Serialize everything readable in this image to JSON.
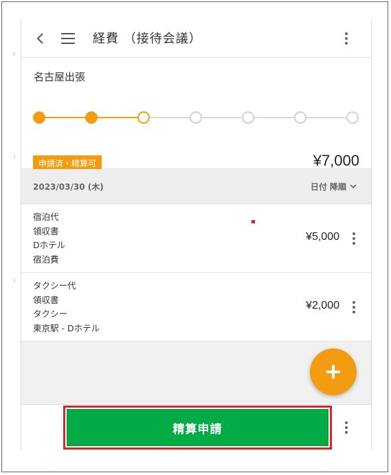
{
  "header": {
    "title": "経費 （接待会議）",
    "back_icon": "chevron-left-icon",
    "menu_icon": "hamburger-menu-icon",
    "more_icon": "kebab-menu-icon"
  },
  "summary": {
    "trip_name": "名古屋出張",
    "status_badge": "申請済・精算可",
    "total_amount": "¥7,000",
    "progress": {
      "total_steps": 7,
      "completed_steps": 2,
      "current_step": 3
    },
    "expand_icon": "chevron-down-icon"
  },
  "list": {
    "date_header": "2023/03/30 (木)",
    "sort_label": "日付 降順",
    "sort_icon": "chevron-down-icon",
    "items": [
      {
        "lines": [
          "宿泊代",
          "領収書",
          "Dホテル",
          "宿泊費"
        ],
        "amount": "¥5,000"
      },
      {
        "lines": [
          "タクシー代",
          "領収書",
          "タクシー",
          "東京駅 - Dホテル"
        ],
        "amount": "¥2,000"
      }
    ]
  },
  "fab": {
    "icon": "plus-icon"
  },
  "footer": {
    "submit_label": "精算申請"
  },
  "colors": {
    "accent": "#f39c12",
    "submit_green": "#00ac45",
    "highlight_red": "#e0202a"
  }
}
